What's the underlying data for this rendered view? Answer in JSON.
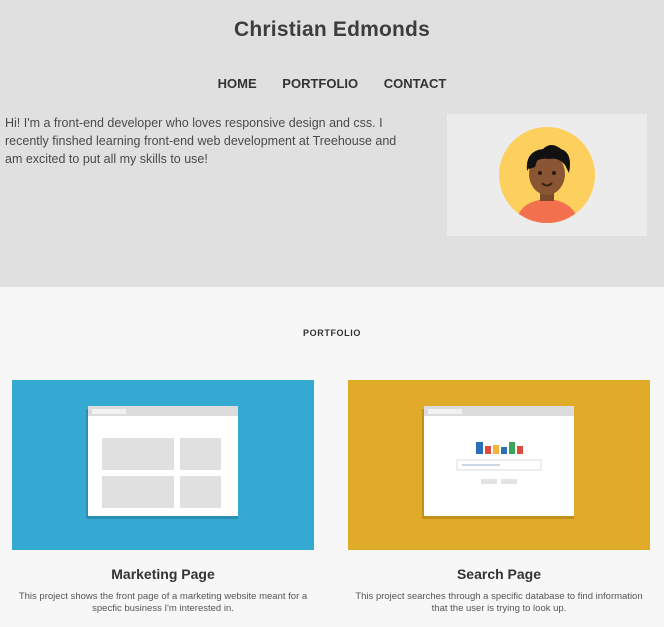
{
  "header": {
    "site_title": "Christian Edmonds",
    "nav": [
      {
        "label": "HOME"
      },
      {
        "label": "PORTFOLIO"
      },
      {
        "label": "CONTACT"
      }
    ]
  },
  "intro": {
    "bio": "Hi! I'm a front-end developer who loves responsive design and css. I recently finshed learning front-end web development at Treehouse and am excited to put all my skills to use!",
    "avatar_icon": "person-avatar-icon"
  },
  "portfolio": {
    "heading": "PORTFOLIO",
    "projects": [
      {
        "title": "Marketing Page",
        "description": "This project shows the front page of a marketing website meant for a specfic business I'm interested in.",
        "thumb_color": "#34a9d2",
        "thumb_icon": "browser-grid-layout-icon"
      },
      {
        "title": "Search Page",
        "description": "This project searches through a specific database to find information that the user is trying to look up.",
        "thumb_color": "#e0ab28",
        "thumb_icon": "browser-search-layout-icon"
      }
    ]
  },
  "colors": {
    "hero_background": "#e0e0e0",
    "page_background": "#f7f7f7",
    "avatar_circle": "#fdcf5d",
    "avatar_shirt": "#f2704e"
  }
}
